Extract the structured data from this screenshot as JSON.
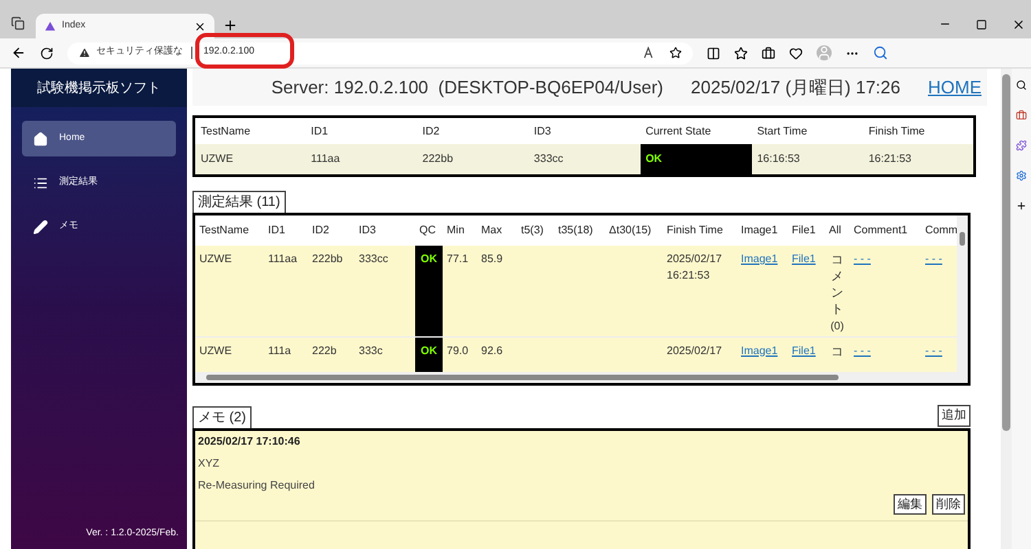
{
  "browser": {
    "tab": {
      "title": "Index",
      "selected": true
    },
    "security": "セキュリティ保護な",
    "address": "192.0.2.100"
  },
  "sidebar": {
    "title": "試験機掲示板ソフト",
    "items": [
      {
        "label": "Home",
        "kind": "home",
        "selected": true
      },
      {
        "label": "測定結果",
        "kind": "list",
        "selected": false
      },
      {
        "label": "メモ",
        "kind": "pencil",
        "selected": false
      }
    ],
    "version": "Ver. : 1.2.0-2025/Feb."
  },
  "header": {
    "server": "Server: 192.0.2.100  (DESKTOP-BQ6EP04/User)",
    "datetime": "2025/02/17 (月曜日) 17:26",
    "home_link": "HOME"
  },
  "current": {
    "columns": [
      "TestName",
      "ID1",
      "ID2",
      "ID3",
      "Current State",
      "Start Time",
      "Finish Time"
    ],
    "row": [
      "UZWE",
      "111aa",
      "222bb",
      "333cc",
      "OK",
      "16:16:53",
      "16:21:53"
    ]
  },
  "results": {
    "title": "測定結果 (11)",
    "columns": [
      "TestName",
      "ID1",
      "ID2",
      "ID3",
      "QC",
      "Min",
      "Max",
      "t5(3)",
      "t35(18)",
      "Δt30(15)",
      "Finish Time",
      "Image1",
      "File1",
      "All",
      "Comment1",
      "Comm"
    ],
    "rows": [
      {
        "cells": [
          {
            "kind": "text",
            "text": "UZWE"
          },
          {
            "kind": "text",
            "text": "111aa"
          },
          {
            "kind": "text",
            "text": "222bb"
          },
          {
            "kind": "text",
            "text": "333cc"
          },
          {
            "kind": "qc",
            "text": "OK"
          },
          {
            "kind": "text",
            "text": "77.1"
          },
          {
            "kind": "text",
            "text": "85.9"
          },
          {
            "kind": "empty"
          },
          {
            "kind": "empty"
          },
          {
            "kind": "empty"
          },
          {
            "kind": "text",
            "text": "2025/02/17 16:21:53"
          },
          {
            "kind": "link",
            "text": "Image1"
          },
          {
            "kind": "link",
            "text": "File1"
          },
          {
            "kind": "vertical",
            "text": "コメント",
            "count": "(0)"
          },
          {
            "kind": "link",
            "text": "- - -"
          },
          {
            "kind": "link",
            "text": "- - -"
          }
        ]
      },
      {
        "cells": [
          {
            "kind": "text",
            "text": "UZWE"
          },
          {
            "kind": "text",
            "text": "111a"
          },
          {
            "kind": "text",
            "text": "222b"
          },
          {
            "kind": "text",
            "text": "333c"
          },
          {
            "kind": "qc",
            "text": "OK"
          },
          {
            "kind": "text",
            "text": "79.0"
          },
          {
            "kind": "text",
            "text": "92.6"
          },
          {
            "kind": "empty"
          },
          {
            "kind": "empty"
          },
          {
            "kind": "empty"
          },
          {
            "kind": "text",
            "text": "2025/02/17"
          },
          {
            "kind": "link",
            "text": "Image1"
          },
          {
            "kind": "link",
            "text": "File1"
          },
          {
            "kind": "vertical",
            "text": "コ"
          },
          {
            "kind": "link",
            "text": "- - -"
          },
          {
            "kind": "link",
            "text": "- - -"
          }
        ]
      }
    ]
  },
  "memo": {
    "title": "メモ (2)",
    "add": "追加",
    "entries": [
      {
        "date": "2025/02/17 17:10:46",
        "lines": [
          "XYZ",
          "Re-Measuring Required"
        ],
        "edit": "編集",
        "delete": "削除"
      }
    ]
  }
}
